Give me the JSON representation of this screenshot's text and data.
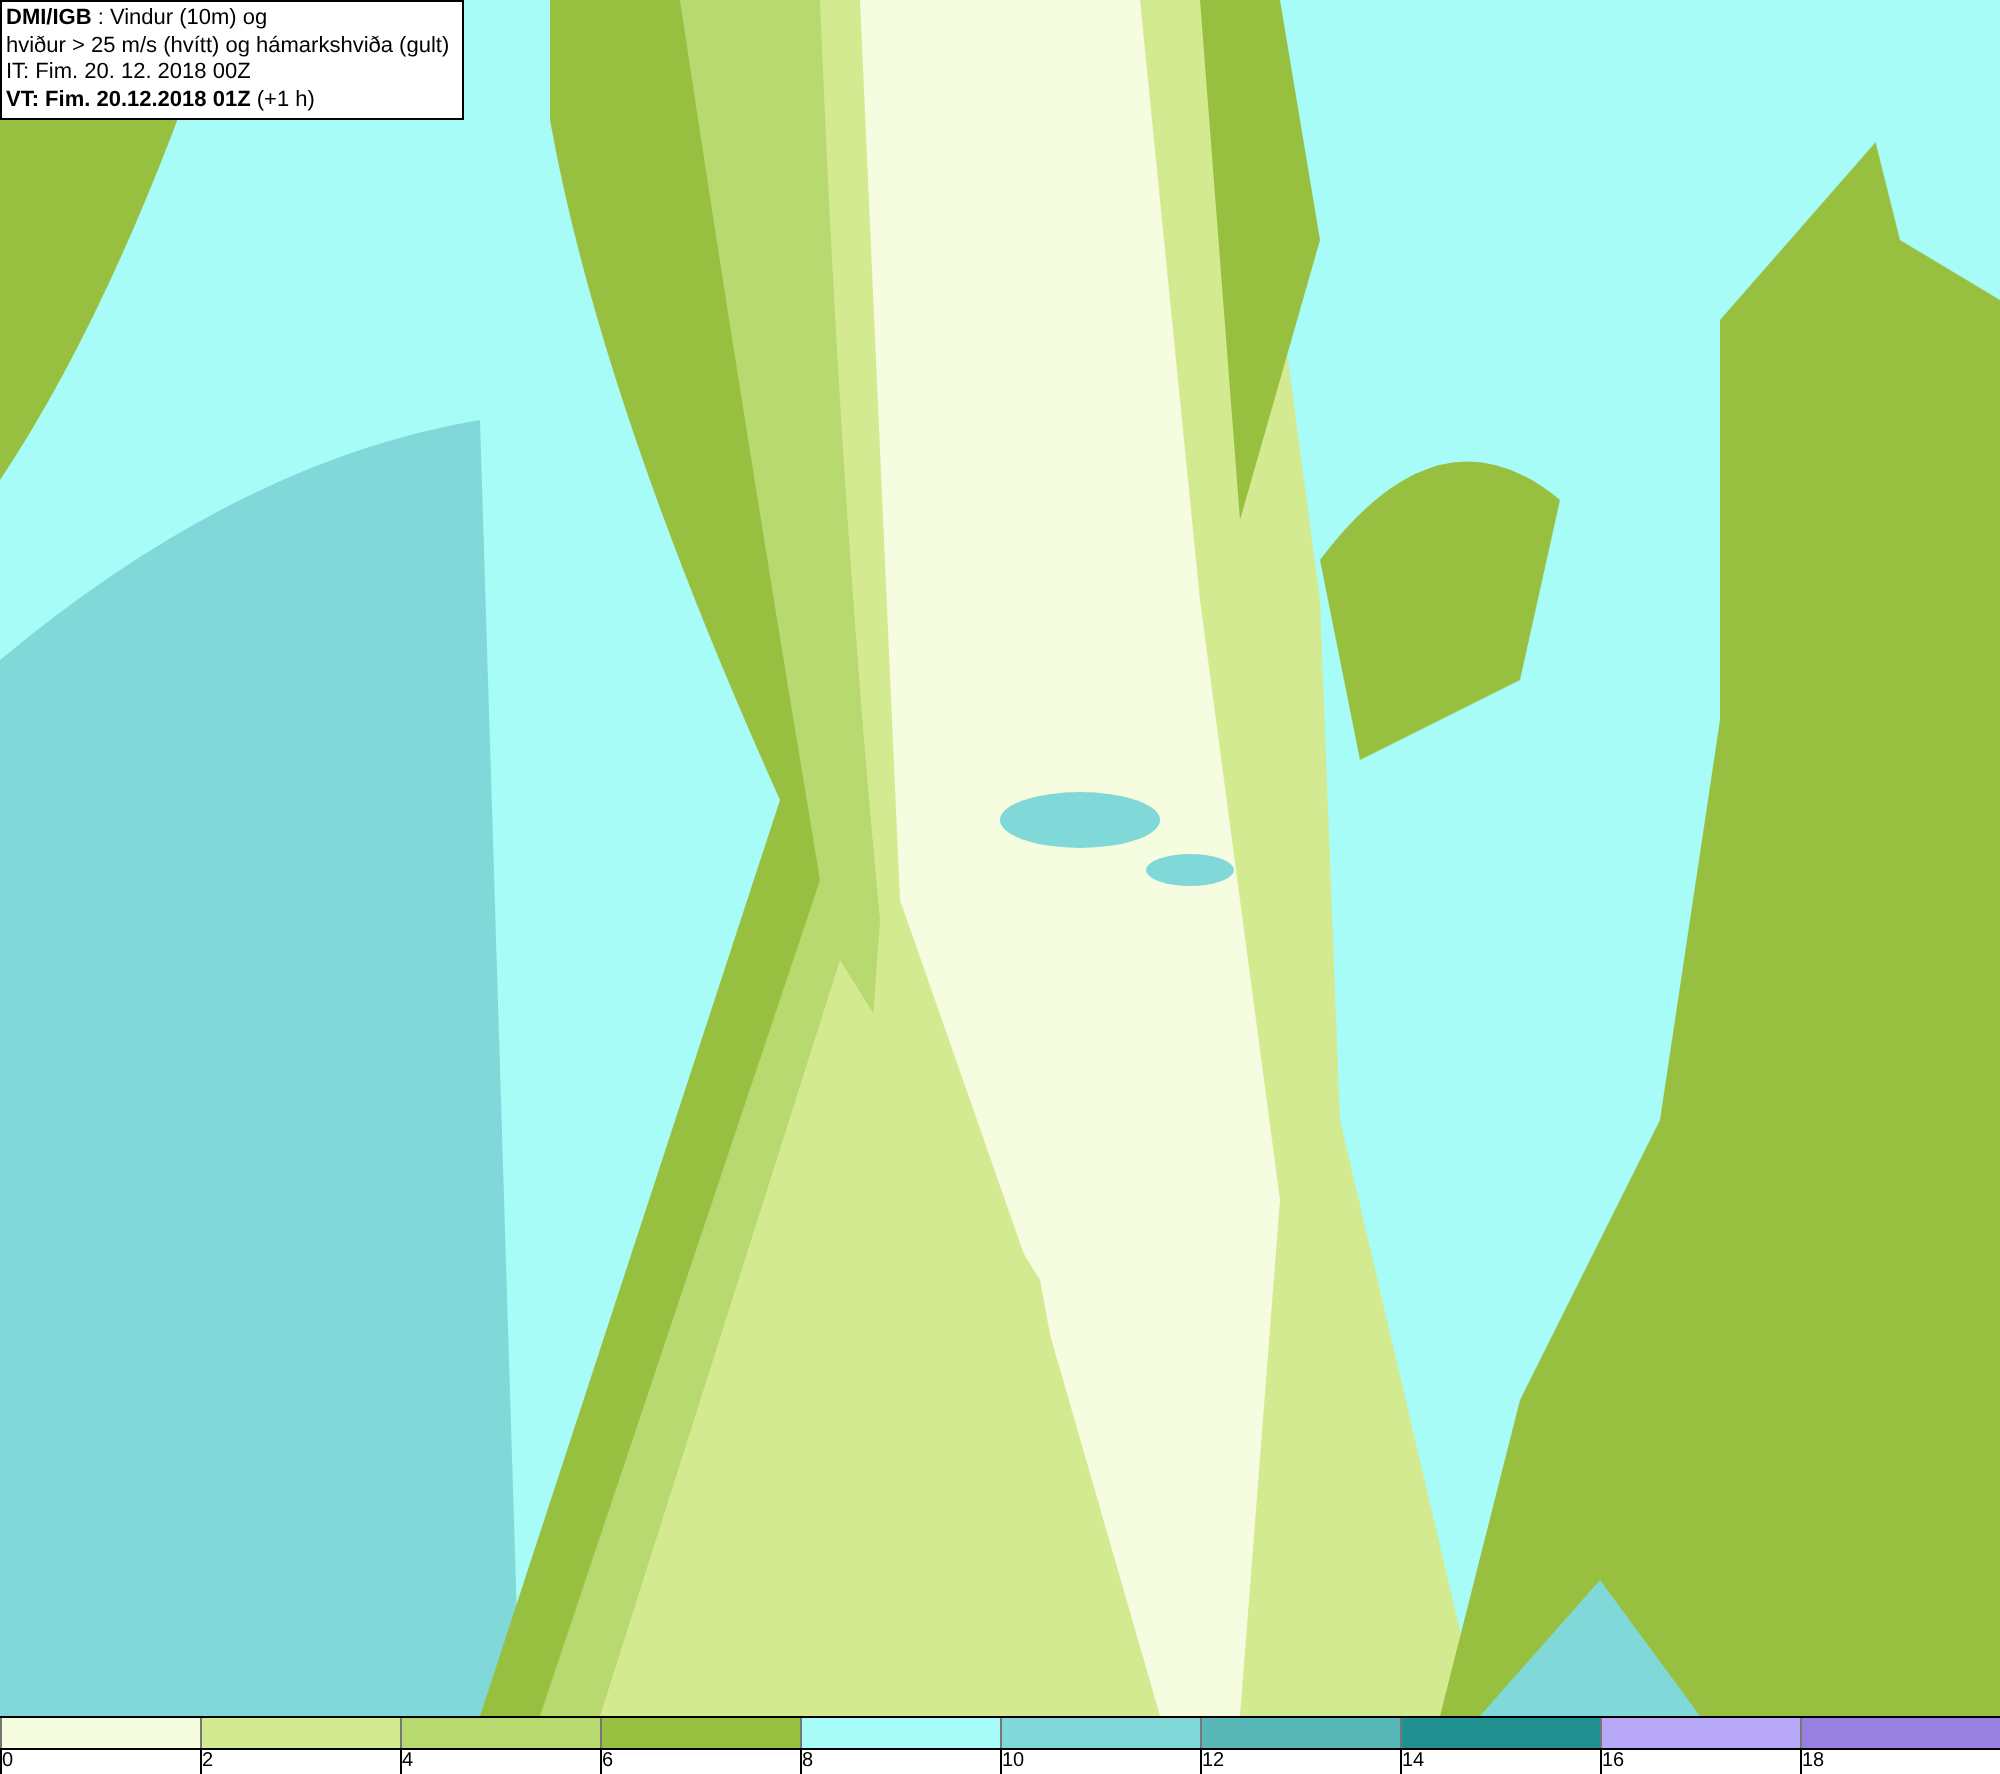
{
  "header": {
    "lines": [
      "**DMI/IGB** : Vindur (10m) og",
      "hviður > 25 m/s (hvítt) og hámarkshviða (gult)",
      "IT: Fim. 20. 12. 2018 00Z",
      "**VT: Fim. 20.12.2018 01Z** (+1 h)"
    ]
  },
  "legend": {
    "bins": [
      {
        "label": "0",
        "color": "#f5fce0"
      },
      {
        "label": "2",
        "color": "#d4ea90"
      },
      {
        "label": "4",
        "color": "#b8d870"
      },
      {
        "label": "6",
        "color": "#98c040"
      },
      {
        "label": "8",
        "color": "#a8fcf8"
      },
      {
        "label": "10",
        "color": "#80d8d8"
      },
      {
        "label": "12",
        "color": "#58b8b8"
      },
      {
        "label": "14",
        "color": "#209090"
      },
      {
        "label": "16",
        "color": "#b8a8f8"
      },
      {
        "label": "18",
        "color": "#9880e0"
      }
    ]
  }
}
